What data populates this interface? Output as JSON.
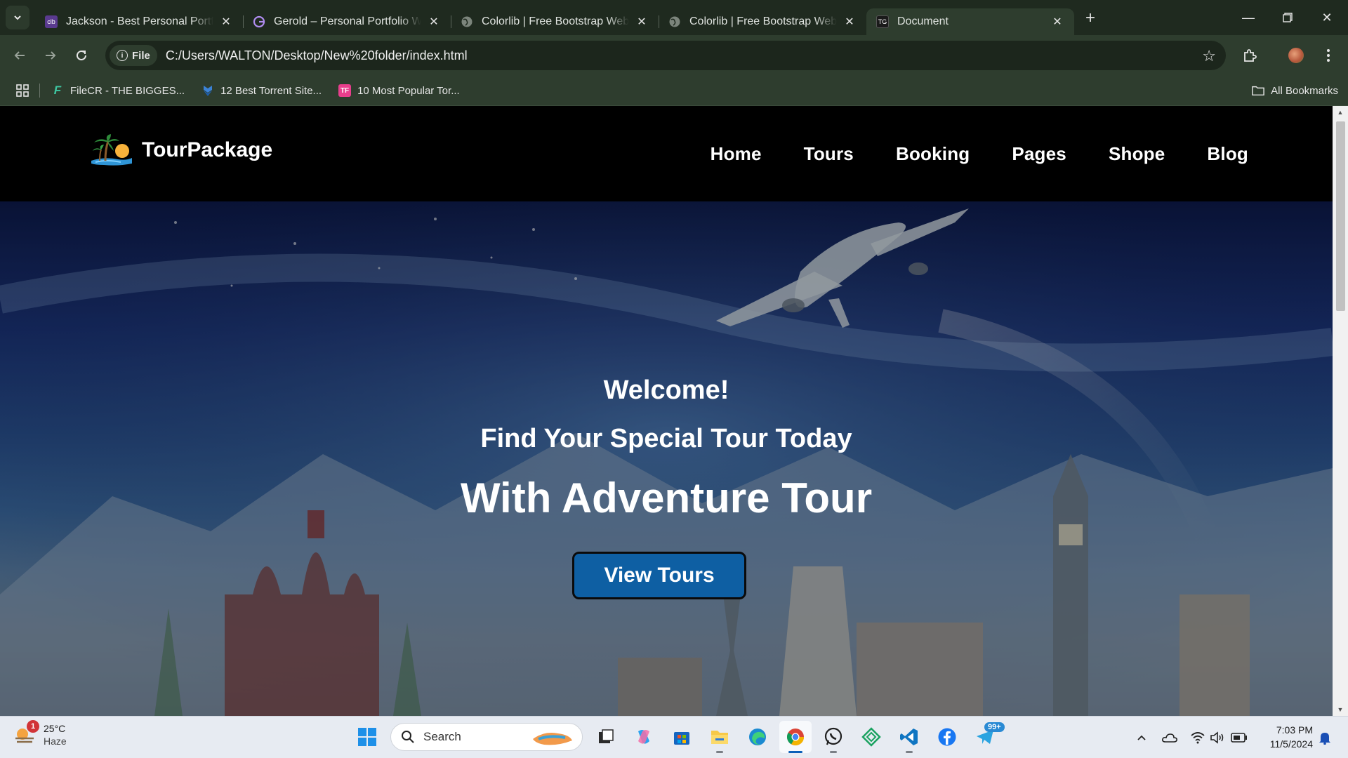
{
  "browser": {
    "tabs": [
      {
        "title": "Jackson - Best Personal Portfolio",
        "favicon": "colorlib-purple-icon",
        "active": false
      },
      {
        "title": "Gerold – Personal Portfolio Wor",
        "favicon": "gerold-g-icon",
        "active": false
      },
      {
        "title": "Colorlib | Free Bootstrap Websit",
        "favicon": "globe-icon",
        "active": false
      },
      {
        "title": "Colorlib | Free Bootstrap Websit",
        "favicon": "globe-icon",
        "active": false
      },
      {
        "title": "Document",
        "favicon": "document-favicon-icon",
        "active": true
      }
    ],
    "site_info_label": "File",
    "url": "C:/Users/WALTON/Desktop/New%20folder/index.html",
    "bookmarks": [
      {
        "label": "FileCR - THE BIGGES...",
        "icon": "filecr-icon"
      },
      {
        "label": "12 Best Torrent Site...",
        "icon": "shield-bookmark-icon"
      },
      {
        "label": "10 Most Popular Tor...",
        "icon": "tf-icon"
      }
    ],
    "all_bookmarks_label": "All Bookmarks"
  },
  "site": {
    "brand": "TourPackage",
    "menu": [
      "Home",
      "Tours",
      "Booking",
      "Pages",
      "Shope",
      "Blog"
    ],
    "hero": {
      "welcome": "Welcome!",
      "subtitle": "Find Your Special Tour Today",
      "headline": "With Adventure Tour",
      "cta": "View Tours"
    },
    "colors": {
      "nav_bg": "#000000",
      "cta_bg": "#0e5fa3"
    }
  },
  "taskbar": {
    "weather": {
      "temp": "25°C",
      "condition": "Haze",
      "badge": "1"
    },
    "search_placeholder": "Search",
    "telegram_badge": "99+",
    "time": "7:03 PM",
    "date": "11/5/2024"
  }
}
